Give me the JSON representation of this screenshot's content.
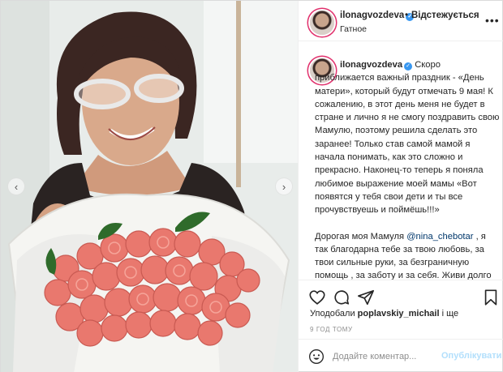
{
  "photo": {
    "alt_description": ""
  },
  "header": {
    "username": "ilonagvozdeva",
    "separator": "•",
    "follow_label": "Відстежується",
    "location": "Гатное"
  },
  "caption": {
    "username": "ilonagvozdeva",
    "paragraph1": "Скоро приближается важный праздник - «День матери», который будут отмечать 9 мая! К сожалению, в этот день меня не будет в стране и лично я не смогу поздравить свою Мамулю, поэтому решила сделать это заранее! Только став самой мамой я начала понимать, как это сложно и прекрасно. Наконец-то теперь я поняла любимое выражение моей мамы «Вот появятся у тебя свои дети и ты все прочувствуешь и поймёшь!!!»",
    "paragraph2_pre": "Дорогая моя Мамуля ",
    "mention": "@nina_chebotar",
    "paragraph2_post": " , я так благодарна тебе за твою любовь, за твои сильные руки, за безграничную помощь , за заботу и за себя. Живи долго"
  },
  "likes": {
    "prefix": "Уподобали ",
    "user": "poplavskiy_michail",
    "suffix": " і ще"
  },
  "time": "9 год тому",
  "comment": {
    "placeholder": "Додайте коментар...",
    "publish_label": "Опублікувати"
  },
  "colors": {
    "accent": "#3897f0",
    "publish_disabled": "#b2dffc",
    "mention": "#00376b",
    "story_ring": "#e1306c"
  },
  "icons": {
    "like": "heart-icon",
    "comment": "comment-icon",
    "share": "send-icon",
    "save": "bookmark-icon",
    "emoji": "emoji-icon",
    "more": "more-icon",
    "prev": "chevron-left-icon",
    "next": "chevron-right-icon"
  }
}
